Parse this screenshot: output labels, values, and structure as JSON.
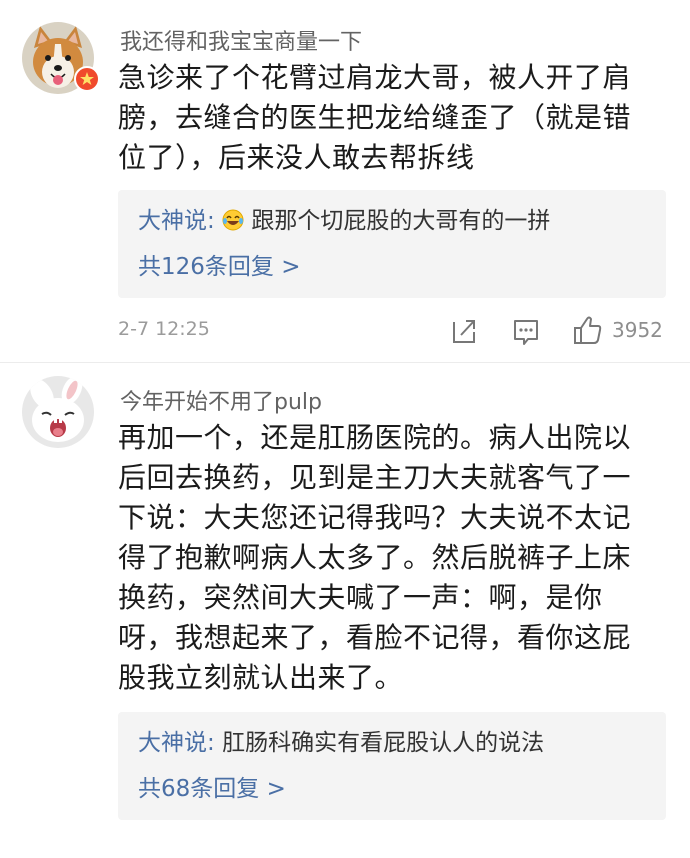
{
  "comments": [
    {
      "username": "我还得和我宝宝商量一下",
      "text": "急诊来了个花臂过肩龙大哥，被人开了肩膀，去缝合的医生把龙给缝歪了（就是错位了），后来没人敢去帮拆线",
      "reply_author": "大神说:",
      "reply_text": "跟那个切屁股的大哥有的一拼",
      "reply_count": "共126条回复 >",
      "timestamp": "2-7 12:25",
      "likes": "3952"
    },
    {
      "username": "今年开始不用了pulp",
      "text": "再加一个，还是肛肠医院的。病人出院以后回去换药，见到是主刀大夫就客气了一下说：大夫您还记得我吗？大夫说不太记得了抱歉啊病人太多了。然后脱裤子上床换药，突然间大夫喊了一声：啊，是你呀，我想起来了，看脸不记得，看你这屁股我立刻就认出来了。",
      "reply_author": "大神说:",
      "reply_text": "肛肠科确实有看屁股认人的说法",
      "reply_count": "共68条回复 >"
    }
  ],
  "colors": {
    "link_blue": "#4a6fa5",
    "badge_red": "#f04a2c",
    "reply_bg": "#f4f4f4"
  },
  "icons": {
    "badge": "verified-star-icon",
    "share": "share-icon",
    "comment": "comment-icon",
    "like": "thumbs-up-icon",
    "emoji": "laughing-tears-emoji-icon"
  }
}
